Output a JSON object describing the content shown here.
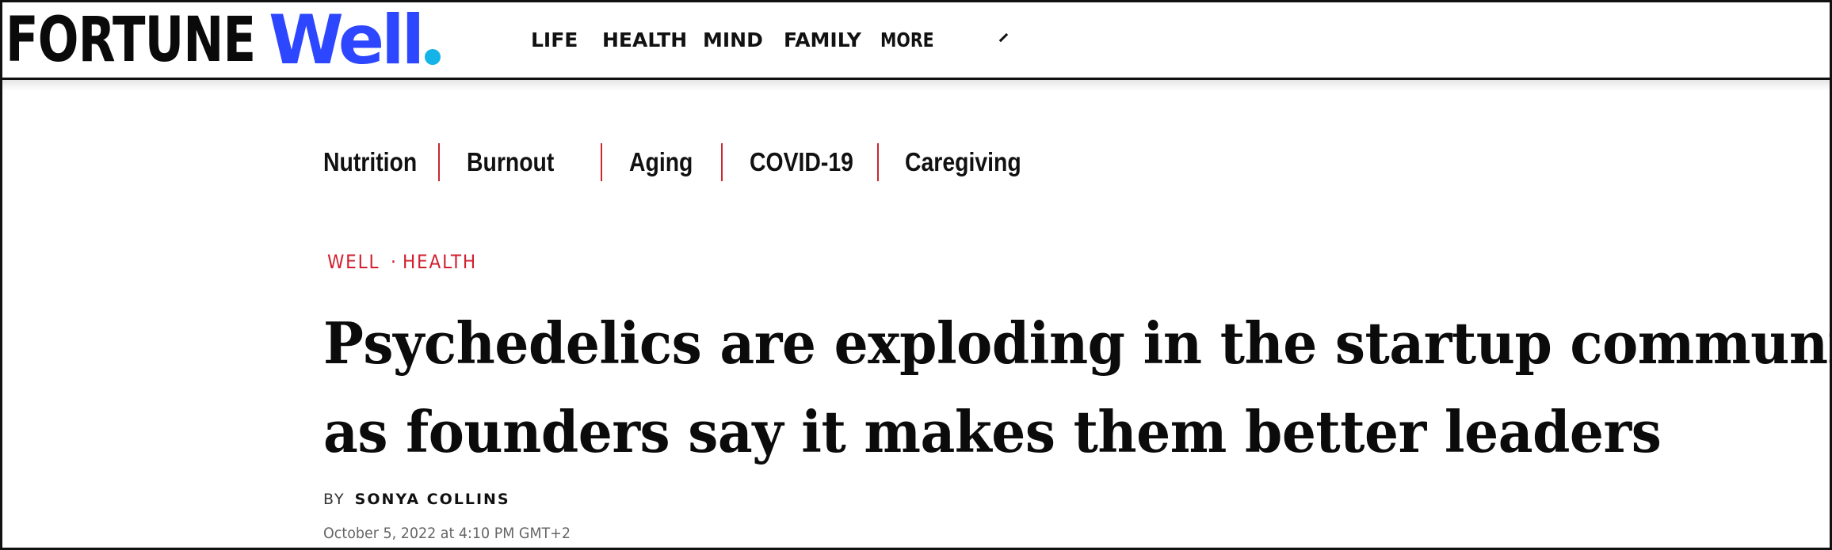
{
  "brand": {
    "wordmark": "FORTUNE",
    "sub_brand": "Well",
    "sub_brand_color": "#2d46ff",
    "dot_color": "#14b4e8"
  },
  "main_nav": {
    "items": [
      {
        "label": "LIFE"
      },
      {
        "label": "HEALTH"
      },
      {
        "label": "MIND"
      },
      {
        "label": "FAMILY"
      },
      {
        "label": "MORE",
        "icon": "chevron-down-icon"
      }
    ]
  },
  "topic_nav": {
    "items": [
      {
        "label": "Nutrition"
      },
      {
        "label": "Burnout"
      },
      {
        "label": "Aging"
      },
      {
        "label": "COVID-19"
      },
      {
        "label": "Caregiving"
      }
    ],
    "separator_color": "#c8282e"
  },
  "article": {
    "kicker_section": "WELL",
    "kicker_separator": "·",
    "kicker_topic": "HEALTH",
    "kicker_color": "#d1202f",
    "headline_line1": "Psychedelics are exploding in the startup community",
    "headline_line2": "as founders say it makes them better leaders",
    "byline_prefix": "BY",
    "author": "SONYA COLLINS",
    "date": "October 5, 2022 at 4:10 PM GMT+2"
  }
}
